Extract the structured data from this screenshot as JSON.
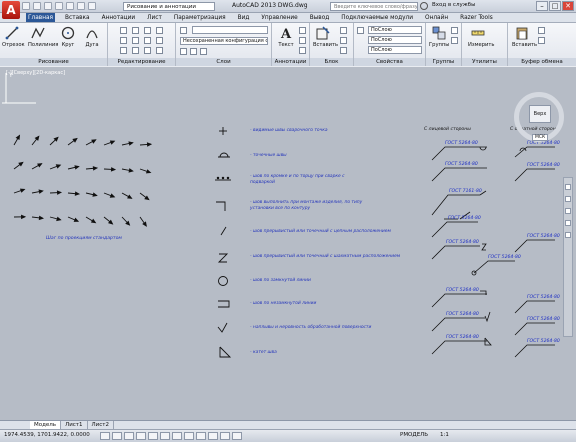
{
  "app": {
    "logo_letter": "A",
    "workspace": "Рисование и аннотации",
    "title": "AutoCAD 2013   DWG.dwg",
    "search_placeholder": "Введите ключевое слово/фразу",
    "signin": "Вход в службы",
    "window_controls": [
      "–",
      "□",
      "✕"
    ]
  },
  "ribbon_tabs": [
    "Главная",
    "Вставка",
    "Аннотации",
    "Лист",
    "Параметризация",
    "Вид",
    "Управление",
    "Вывод",
    "Подключаемые модули",
    "Онлайн",
    "Razer Tools"
  ],
  "panels": {
    "draw": {
      "label": "Рисование",
      "buttons": [
        "Отрезок",
        "Полилиния",
        "Круг",
        "Дуга"
      ]
    },
    "modify": {
      "label": "Редактирование"
    },
    "layers": {
      "label": "Слои",
      "dropdown": "Несохраненная конфигурация слоя"
    },
    "annotation": {
      "label": "Аннотации",
      "button": "Текст"
    },
    "block": {
      "label": "Блок",
      "button": "Вставить"
    },
    "properties": {
      "label": "Свойства",
      "rows": [
        "ПоСлою",
        "ПоСлою",
        "ПоСлою"
      ]
    },
    "groups": {
      "label": "Группы",
      "button": "Группы"
    },
    "utilities": {
      "label": "Утилиты",
      "button": "Измерить"
    },
    "clipboard": {
      "label": "Буфер обмена",
      "button": "Вставить"
    }
  },
  "drawing": {
    "viewport_label": "[-][Сверху][2D-каркас]",
    "viewcube_face": "Верх",
    "viewcube_compass": "МСК",
    "ucs_label": "Y",
    "arrows_caption": "Шаг по проекциям стандартом",
    "column_heads": [
      "С лицевой стороны",
      "С обратной стороны"
    ],
    "legend": [
      "- видимые швы сварочного точка",
      "- точечные швы",
      "- шов по кромке и по торцу при сварке с подваркой",
      "- шов выполнить при монтаже изделия, по типу установки все по контуру",
      "- шов прерывистый или точечный с цепным расположением",
      "- шов прерывистый или точечный с шахматным расположением",
      "- шов по замкнутой линии",
      "- шов по незамкнутой линии",
      "- наплывы и неровность обработанной поверхности",
      "- катет шва"
    ],
    "gost_left": [
      "ГОСТ 5264-80",
      "ГОСТ 5264-80",
      "ГОСТ 7161-80",
      "ГОСТ 5264-80",
      "ГОСТ 5264-80",
      "ГОСТ 5264-80",
      "ГОСТ 5264-80",
      "ГОСТ 5264-80"
    ],
    "gost_right": [
      "ГОСТ 5264-80",
      "ГОСТ 5264-80",
      "ГОСТ 5264-80",
      "ГОСТ 5264-80",
      "ГОСТ 5264-80",
      "ГОСТ 5264-80",
      "ГОСТ 5264-80"
    ]
  },
  "layout_tabs": [
    "Модель",
    "Лист1",
    "Лист2"
  ],
  "status": {
    "coords": "1974.4539, 1701.9422, 0.0000",
    "model": "РМОДЕЛЬ",
    "scale": "1:1"
  }
}
